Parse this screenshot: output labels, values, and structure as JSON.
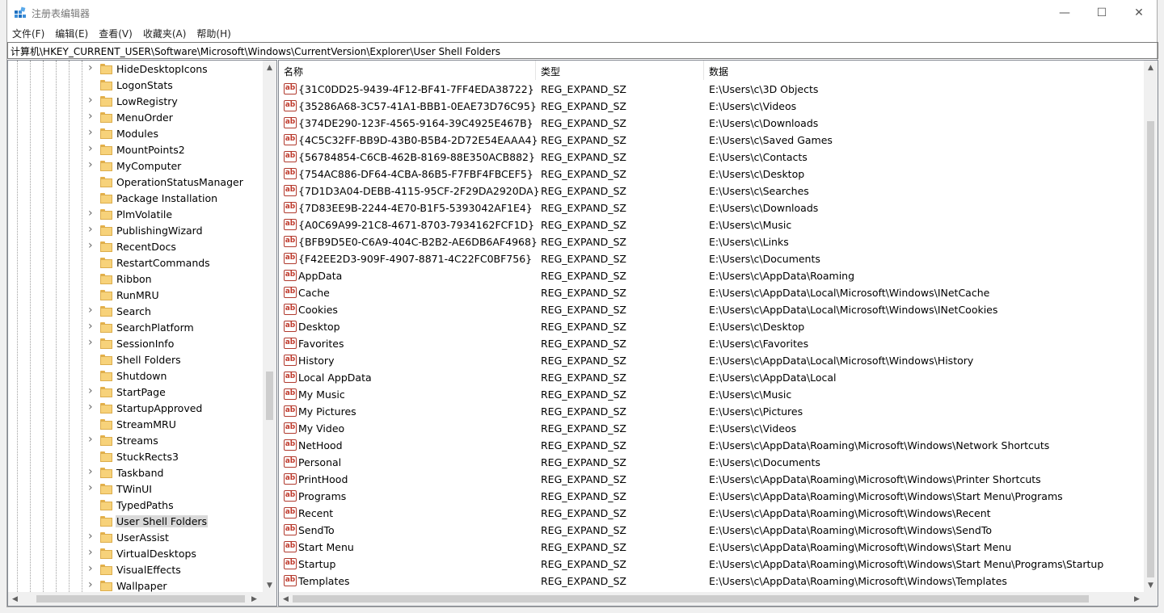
{
  "window": {
    "title": "注册表编辑器",
    "controls": {
      "minimize": "—",
      "maximize": "☐",
      "close": "✕"
    }
  },
  "menu": [
    "文件(F)",
    "编辑(E)",
    "查看(V)",
    "收藏夹(A)",
    "帮助(H)"
  ],
  "address": "计算机\\HKEY_CURRENT_USER\\Software\\Microsoft\\Windows\\CurrentVersion\\Explorer\\User Shell Folders",
  "tree": {
    "items": [
      {
        "label": "HideDesktopIcons",
        "expandable": true
      },
      {
        "label": "LogonStats",
        "expandable": false
      },
      {
        "label": "LowRegistry",
        "expandable": true
      },
      {
        "label": "MenuOrder",
        "expandable": true
      },
      {
        "label": "Modules",
        "expandable": true
      },
      {
        "label": "MountPoints2",
        "expandable": true
      },
      {
        "label": "MyComputer",
        "expandable": true
      },
      {
        "label": "OperationStatusManager",
        "expandable": false
      },
      {
        "label": "Package Installation",
        "expandable": false
      },
      {
        "label": "PlmVolatile",
        "expandable": true
      },
      {
        "label": "PublishingWizard",
        "expandable": true
      },
      {
        "label": "RecentDocs",
        "expandable": true
      },
      {
        "label": "RestartCommands",
        "expandable": false
      },
      {
        "label": "Ribbon",
        "expandable": false
      },
      {
        "label": "RunMRU",
        "expandable": false
      },
      {
        "label": "Search",
        "expandable": true
      },
      {
        "label": "SearchPlatform",
        "expandable": true
      },
      {
        "label": "SessionInfo",
        "expandable": true
      },
      {
        "label": "Shell Folders",
        "expandable": false
      },
      {
        "label": "Shutdown",
        "expandable": false
      },
      {
        "label": "StartPage",
        "expandable": true
      },
      {
        "label": "StartupApproved",
        "expandable": true
      },
      {
        "label": "StreamMRU",
        "expandable": false
      },
      {
        "label": "Streams",
        "expandable": true
      },
      {
        "label": "StuckRects3",
        "expandable": false
      },
      {
        "label": "Taskband",
        "expandable": true
      },
      {
        "label": "TWinUI",
        "expandable": true
      },
      {
        "label": "TypedPaths",
        "expandable": false
      },
      {
        "label": "User Shell Folders",
        "expandable": false,
        "selected": true
      },
      {
        "label": "UserAssist",
        "expandable": true
      },
      {
        "label": "VirtualDesktops",
        "expandable": true
      },
      {
        "label": "VisualEffects",
        "expandable": true
      },
      {
        "label": "Wallpaper",
        "expandable": true
      }
    ]
  },
  "list": {
    "columns": [
      "名称",
      "类型",
      "数据"
    ],
    "rows": [
      {
        "name": "{31C0DD25-9439-4F12-BF41-7FF4EDA38722}",
        "type": "REG_EXPAND_SZ",
        "data": "E:\\Users\\c\\3D Objects"
      },
      {
        "name": "{35286A68-3C57-41A1-BBB1-0EAE73D76C95}",
        "type": "REG_EXPAND_SZ",
        "data": "E:\\Users\\c\\Videos"
      },
      {
        "name": "{374DE290-123F-4565-9164-39C4925E467B}",
        "type": "REG_EXPAND_SZ",
        "data": "E:\\Users\\c\\Downloads"
      },
      {
        "name": "{4C5C32FF-BB9D-43B0-B5B4-2D72E54EAAA4}",
        "type": "REG_EXPAND_SZ",
        "data": "E:\\Users\\c\\Saved Games"
      },
      {
        "name": "{56784854-C6CB-462B-8169-88E350ACB882}",
        "type": "REG_EXPAND_SZ",
        "data": "E:\\Users\\c\\Contacts"
      },
      {
        "name": "{754AC886-DF64-4CBA-86B5-F7FBF4FBCEF5}",
        "type": "REG_EXPAND_SZ",
        "data": "E:\\Users\\c\\Desktop"
      },
      {
        "name": "{7D1D3A04-DEBB-4115-95CF-2F29DA2920DA}",
        "type": "REG_EXPAND_SZ",
        "data": "E:\\Users\\c\\Searches"
      },
      {
        "name": "{7D83EE9B-2244-4E70-B1F5-5393042AF1E4}",
        "type": "REG_EXPAND_SZ",
        "data": "E:\\Users\\c\\Downloads"
      },
      {
        "name": "{A0C69A99-21C8-4671-8703-7934162FCF1D}",
        "type": "REG_EXPAND_SZ",
        "data": "E:\\Users\\c\\Music"
      },
      {
        "name": "{BFB9D5E0-C6A9-404C-B2B2-AE6DB6AF4968}",
        "type": "REG_EXPAND_SZ",
        "data": "E:\\Users\\c\\Links"
      },
      {
        "name": "{F42EE2D3-909F-4907-8871-4C22FC0BF756}",
        "type": "REG_EXPAND_SZ",
        "data": "E:\\Users\\c\\Documents"
      },
      {
        "name": "AppData",
        "type": "REG_EXPAND_SZ",
        "data": "E:\\Users\\c\\AppData\\Roaming"
      },
      {
        "name": "Cache",
        "type": "REG_EXPAND_SZ",
        "data": "E:\\Users\\c\\AppData\\Local\\Microsoft\\Windows\\INetCache"
      },
      {
        "name": "Cookies",
        "type": "REG_EXPAND_SZ",
        "data": "E:\\Users\\c\\AppData\\Local\\Microsoft\\Windows\\INetCookies"
      },
      {
        "name": "Desktop",
        "type": "REG_EXPAND_SZ",
        "data": "E:\\Users\\c\\Desktop"
      },
      {
        "name": "Favorites",
        "type": "REG_EXPAND_SZ",
        "data": "E:\\Users\\c\\Favorites"
      },
      {
        "name": "History",
        "type": "REG_EXPAND_SZ",
        "data": "E:\\Users\\c\\AppData\\Local\\Microsoft\\Windows\\History"
      },
      {
        "name": "Local AppData",
        "type": "REG_EXPAND_SZ",
        "data": "E:\\Users\\c\\AppData\\Local"
      },
      {
        "name": "My Music",
        "type": "REG_EXPAND_SZ",
        "data": "E:\\Users\\c\\Music"
      },
      {
        "name": "My Pictures",
        "type": "REG_EXPAND_SZ",
        "data": "E:\\Users\\c\\Pictures"
      },
      {
        "name": "My Video",
        "type": "REG_EXPAND_SZ",
        "data": "E:\\Users\\c\\Videos"
      },
      {
        "name": "NetHood",
        "type": "REG_EXPAND_SZ",
        "data": "E:\\Users\\c\\AppData\\Roaming\\Microsoft\\Windows\\Network Shortcuts"
      },
      {
        "name": "Personal",
        "type": "REG_EXPAND_SZ",
        "data": "E:\\Users\\c\\Documents"
      },
      {
        "name": "PrintHood",
        "type": "REG_EXPAND_SZ",
        "data": "E:\\Users\\c\\AppData\\Roaming\\Microsoft\\Windows\\Printer Shortcuts"
      },
      {
        "name": "Programs",
        "type": "REG_EXPAND_SZ",
        "data": "E:\\Users\\c\\AppData\\Roaming\\Microsoft\\Windows\\Start Menu\\Programs"
      },
      {
        "name": "Recent",
        "type": "REG_EXPAND_SZ",
        "data": "E:\\Users\\c\\AppData\\Roaming\\Microsoft\\Windows\\Recent"
      },
      {
        "name": "SendTo",
        "type": "REG_EXPAND_SZ",
        "data": "E:\\Users\\c\\AppData\\Roaming\\Microsoft\\Windows\\SendTo"
      },
      {
        "name": "Start Menu",
        "type": "REG_EXPAND_SZ",
        "data": "E:\\Users\\c\\AppData\\Roaming\\Microsoft\\Windows\\Start Menu"
      },
      {
        "name": "Startup",
        "type": "REG_EXPAND_SZ",
        "data": "E:\\Users\\c\\AppData\\Roaming\\Microsoft\\Windows\\Start Menu\\Programs\\Startup"
      },
      {
        "name": "Templates",
        "type": "REG_EXPAND_SZ",
        "data": "E:\\Users\\c\\AppData\\Roaming\\Microsoft\\Windows\\Templates"
      }
    ]
  },
  "icons": {
    "value": "ab",
    "folder": "folder-icon",
    "app": "regedit-icon"
  },
  "colors": {
    "selection": "#d9d9d9",
    "folder": "#f7d27a",
    "value_icon": "#c0392b"
  }
}
